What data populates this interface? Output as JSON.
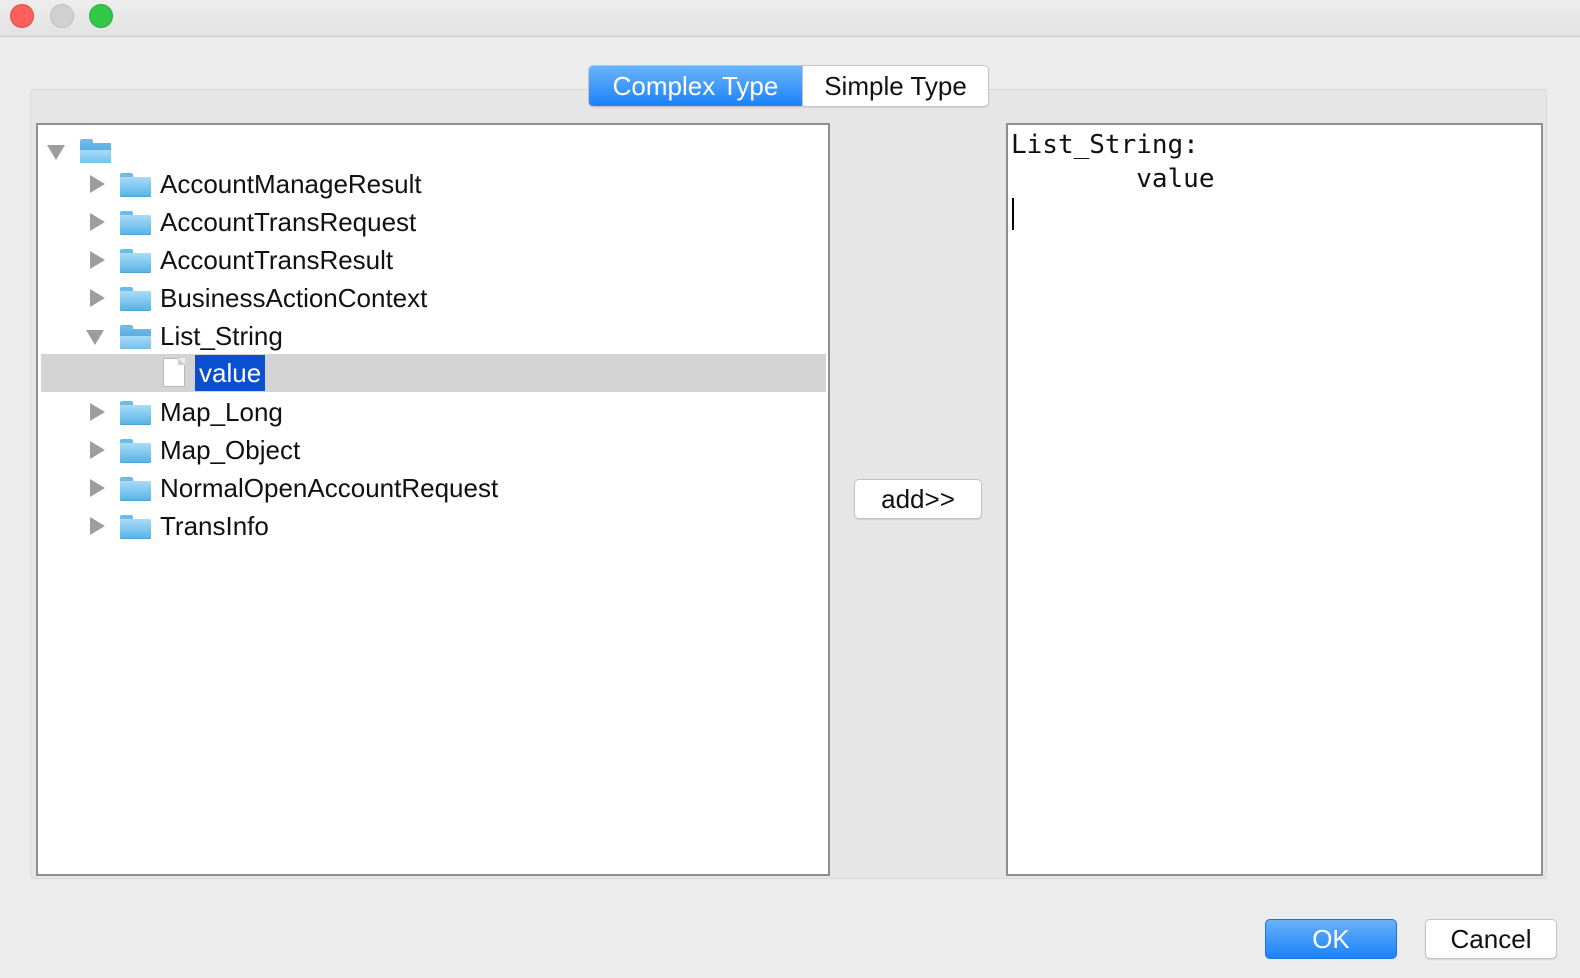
{
  "window": {
    "controls": [
      "close-button",
      "minimize-button",
      "zoom-button"
    ]
  },
  "tabs": {
    "active": "Complex Type",
    "inactive": "Simple Type"
  },
  "tree": {
    "root_label": "",
    "items": [
      {
        "label": "AccountManageResult",
        "expanded": false
      },
      {
        "label": "AccountTransRequest",
        "expanded": false
      },
      {
        "label": "AccountTransResult",
        "expanded": false
      },
      {
        "label": "BusinessActionContext",
        "expanded": false
      },
      {
        "label": "List_String",
        "expanded": true,
        "children": [
          {
            "label": "value",
            "selected": true
          }
        ]
      },
      {
        "label": "Map_Long",
        "expanded": false
      },
      {
        "label": "Map_Object",
        "expanded": false
      },
      {
        "label": "NormalOpenAccountRequest",
        "expanded": false
      },
      {
        "label": "TransInfo",
        "expanded": false
      }
    ]
  },
  "add_button": "add>>",
  "editor": {
    "lines": [
      "List_String:",
      "        value"
    ]
  },
  "footer": {
    "ok": "OK",
    "cancel": "Cancel"
  },
  "colors": {
    "accent": "#1a82fb",
    "selection": "#0a4fcf",
    "row_highlight": "#d4d4d4"
  }
}
